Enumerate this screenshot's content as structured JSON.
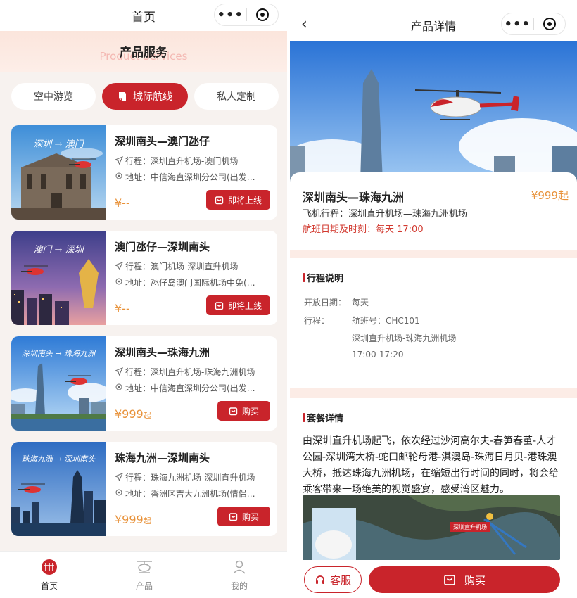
{
  "left": {
    "header": {
      "title": "首页"
    },
    "banner": {
      "title": "产品服务",
      "subtitle": "Product Services"
    },
    "tabs": [
      {
        "label": "空中游览"
      },
      {
        "label": "城际航线"
      },
      {
        "label": "私人定制"
      }
    ],
    "cards": [
      {
        "route_text": "深圳 → 澳门",
        "name": "深圳南头—澳门氹仔",
        "itinerary": "行程：深圳直升机场-澳门机场",
        "address": "地址：中信海直深圳分公司(出发…",
        "price": "¥--",
        "price_suffix": "",
        "button": "即将上线"
      },
      {
        "route_text": "澳门 → 深圳",
        "name": "澳门氹仔—深圳南头",
        "itinerary": "行程：澳门机场-深圳直升机场",
        "address": "地址：氹仔岛澳门国际机场中免(…",
        "price": "¥--",
        "price_suffix": "",
        "button": "即将上线"
      },
      {
        "route_text": "深圳南头 → 珠海九洲",
        "name": "深圳南头—珠海九洲",
        "itinerary": "行程：深圳直升机场-珠海九洲机场",
        "address": "地址：中信海直深圳分公司(出发…",
        "price": "¥999",
        "price_suffix": "起",
        "button": "购买"
      },
      {
        "route_text": "珠海九洲 → 深圳南头",
        "name": "珠海九洲—深圳南头",
        "itinerary": "行程：珠海九洲机场-深圳直升机场",
        "address": "地址：香洲区吉大九洲机场(情侣…",
        "price": "¥999",
        "price_suffix": "起",
        "button": "购买"
      }
    ],
    "tabbar": [
      {
        "label": "首页"
      },
      {
        "label": "产品"
      },
      {
        "label": "我的"
      }
    ]
  },
  "right": {
    "header": {
      "title": "产品详情"
    },
    "product": {
      "name": "深圳南头—珠海九洲",
      "price": "¥999起",
      "route": "飞机行程：深圳直升机场—珠海九洲机场",
      "schedule": "航班日期及时刻：每天 17:00"
    },
    "itinerary": {
      "title": "行程说明",
      "open_label": "开放日期：",
      "open_value": "每天",
      "trip_label": "行程：",
      "flight_no": "航班号：CHC101",
      "route": "深圳直升机场-珠海九洲机场",
      "time": "17:00-17:20"
    },
    "package": {
      "title": "套餐详情",
      "description": "由深圳直升机场起飞，依次经过沙河高尔夫-春笋春茧-人才公园-深圳湾大桥-蛇口邮轮母港-淇澳岛-珠海日月贝-港珠澳大桥，抵达珠海九洲机场，在缩短出行时间的同时，将会给乘客带来一场绝美的视觉盛宴，感受湾区魅力。",
      "map_label": "深圳直升机场"
    },
    "bottom": {
      "service": "客服",
      "buy": "购买"
    }
  },
  "colors": {
    "accent": "#c9242b",
    "price": "#e8923a",
    "schedule": "#d23a30",
    "banner_bg": "#fbe5dc"
  }
}
